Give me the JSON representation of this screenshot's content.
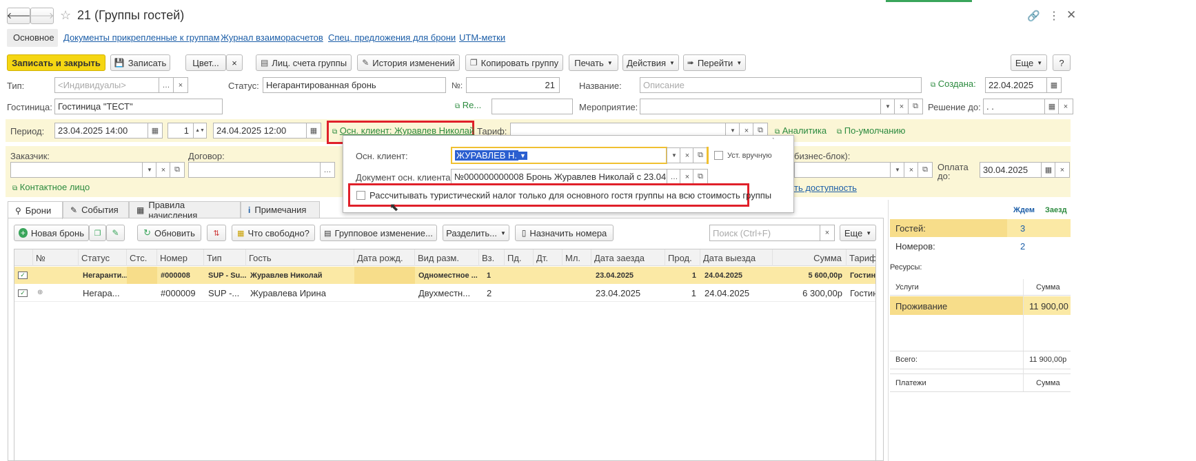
{
  "window": {
    "title": "21 (Группы гостей)"
  },
  "nav": [
    "Основное",
    "Документы прикрепленные к группам",
    "Журнал взаиморасчетов",
    "Спец. предложения для брони",
    "UTM-метки"
  ],
  "toolbar": {
    "save_close": "Записать и закрыть",
    "save": "Записать",
    "color": "Цвет...",
    "accounts": "Лиц. счета группы",
    "history": "История изменений",
    "copy": "Копировать группу",
    "print": "Печать",
    "actions": "Действия",
    "goto": "Перейти",
    "more": "Еще",
    "help": "?"
  },
  "form": {
    "type_label": "Тип:",
    "type_placeholder": "<Индивидуалы>",
    "status_label": "Статус:",
    "status_value": "Негарантированная бронь",
    "num_label": "№:",
    "num_value": "21",
    "name_label": "Название:",
    "name_placeholder": "Описание",
    "created_label": "Создана:",
    "created_value": "22.04.2025",
    "hotel_label": "Гостиница:",
    "hotel_value": "Гостиница \"ТЕСТ\"",
    "re_label": "Re...",
    "event_label": "Мероприятие:",
    "decision_label": "Решение до:",
    "decision_value": ". .",
    "period_label": "Период:",
    "period_from": "23.04.2025 14:00",
    "nights": "1",
    "period_to": "24.04.2025 12:00",
    "main_client_link": "Осн. клиент: Журавлев Николай",
    "tariff_label": "Тариф:",
    "analytics_link": "Аналитика",
    "default_link": "По-умолчанию",
    "customer_label": "Заказчик:",
    "contract_label": "Договор:",
    "bizblock_label": "бизнес-блок):",
    "pay_label": "Оплата до:",
    "pay_value": "30.04.2025",
    "contact_link": "Контактное лицо",
    "availability_link": "ть доступность"
  },
  "popup": {
    "client_label": "Осн. клиент:",
    "client_value": "ЖУРАВЛЕВ Н.",
    "manual_label": "Уст. вручную",
    "doc_label": "Документ осн. клиента:",
    "doc_value": "№000000000008 Бронь Журавлев Николай с 23.04.2025",
    "tax_label": "Рассчитывать туристический налог только для основного гостя группы на всю стоимость группы"
  },
  "tabs": [
    "Брони",
    "События",
    "Правила начисления",
    "Примечания"
  ],
  "list_toolbar": {
    "new": "Новая бронь",
    "refresh": "Обновить",
    "free": "Что свободно?",
    "group_change": "Групповое изменение...",
    "split": "Разделить...",
    "assign": "Назначить номера",
    "search_placeholder": "Поиск (Ctrl+F)",
    "more": "Еще"
  },
  "table": {
    "columns": [
      "№",
      "Статус",
      "Стс.",
      "Номер",
      "Тип",
      "Гость",
      "Дата рожд.",
      "Вид разм.",
      "Вз.",
      "Пд.",
      "Дт.",
      "Мл.",
      "Дата заезда",
      "Прод.",
      "Дата выезда",
      "Сумма",
      "Тариф"
    ],
    "rows": [
      {
        "status": "Негаранти...",
        "room": "#000008",
        "type": "SUP - Su...",
        "guest": "Журавлев Николай",
        "acc": "Одноместное ...",
        "adults": "1",
        "arrival": "23.04.2025",
        "dur": "1",
        "departure": "24.04.2025",
        "sum": "5 600,00р",
        "tariff": "Гостини..."
      },
      {
        "status": "Негара...",
        "room": "#000009",
        "type": "SUP -...",
        "guest": "Журавлева Ирина",
        "acc": "Двухместн...",
        "adults": "2",
        "arrival": "23.04.2025",
        "dur": "1",
        "departure": "24.04.2025",
        "sum": "6 300,00р",
        "tariff": "Гостин..."
      }
    ]
  },
  "side": {
    "wait": "Ждем",
    "checkin": "Заезд",
    "guests_label": "Гостей:",
    "guests": "3",
    "rooms_label": "Номеров:",
    "rooms": "2",
    "resources": "Ресурсы:",
    "services": "Услуги",
    "sum": "Сумма",
    "living": "Проживание",
    "living_sum": "11 900,00",
    "total": "Всего:",
    "total_sum": "11 900,00р",
    "payments": "Платежи",
    "pay_sum": "Сумма"
  },
  "colors": {
    "accent_yellow": "#f5d613",
    "highlight": "#fbe9a5",
    "red_box": "#e0202a",
    "link": "#1c5ea8",
    "green": "#2b8a3e"
  }
}
